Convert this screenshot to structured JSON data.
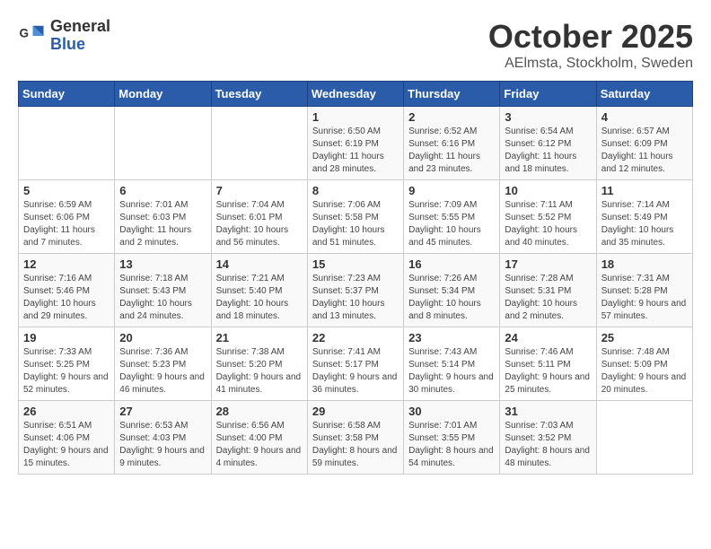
{
  "header": {
    "logo_general": "General",
    "logo_blue": "Blue",
    "title": "October 2025",
    "subtitle": "AElmsta, Stockholm, Sweden"
  },
  "weekdays": [
    "Sunday",
    "Monday",
    "Tuesday",
    "Wednesday",
    "Thursday",
    "Friday",
    "Saturday"
  ],
  "weeks": [
    [
      {
        "day": "",
        "info": ""
      },
      {
        "day": "",
        "info": ""
      },
      {
        "day": "",
        "info": ""
      },
      {
        "day": "1",
        "info": "Sunrise: 6:50 AM\nSunset: 6:19 PM\nDaylight: 11 hours\nand 28 minutes."
      },
      {
        "day": "2",
        "info": "Sunrise: 6:52 AM\nSunset: 6:16 PM\nDaylight: 11 hours\nand 23 minutes."
      },
      {
        "day": "3",
        "info": "Sunrise: 6:54 AM\nSunset: 6:12 PM\nDaylight: 11 hours\nand 18 minutes."
      },
      {
        "day": "4",
        "info": "Sunrise: 6:57 AM\nSunset: 6:09 PM\nDaylight: 11 hours\nand 12 minutes."
      }
    ],
    [
      {
        "day": "5",
        "info": "Sunrise: 6:59 AM\nSunset: 6:06 PM\nDaylight: 11 hours\nand 7 minutes."
      },
      {
        "day": "6",
        "info": "Sunrise: 7:01 AM\nSunset: 6:03 PM\nDaylight: 11 hours\nand 2 minutes."
      },
      {
        "day": "7",
        "info": "Sunrise: 7:04 AM\nSunset: 6:01 PM\nDaylight: 10 hours\nand 56 minutes."
      },
      {
        "day": "8",
        "info": "Sunrise: 7:06 AM\nSunset: 5:58 PM\nDaylight: 10 hours\nand 51 minutes."
      },
      {
        "day": "9",
        "info": "Sunrise: 7:09 AM\nSunset: 5:55 PM\nDaylight: 10 hours\nand 45 minutes."
      },
      {
        "day": "10",
        "info": "Sunrise: 7:11 AM\nSunset: 5:52 PM\nDaylight: 10 hours\nand 40 minutes."
      },
      {
        "day": "11",
        "info": "Sunrise: 7:14 AM\nSunset: 5:49 PM\nDaylight: 10 hours\nand 35 minutes."
      }
    ],
    [
      {
        "day": "12",
        "info": "Sunrise: 7:16 AM\nSunset: 5:46 PM\nDaylight: 10 hours\nand 29 minutes."
      },
      {
        "day": "13",
        "info": "Sunrise: 7:18 AM\nSunset: 5:43 PM\nDaylight: 10 hours\nand 24 minutes."
      },
      {
        "day": "14",
        "info": "Sunrise: 7:21 AM\nSunset: 5:40 PM\nDaylight: 10 hours\nand 18 minutes."
      },
      {
        "day": "15",
        "info": "Sunrise: 7:23 AM\nSunset: 5:37 PM\nDaylight: 10 hours\nand 13 minutes."
      },
      {
        "day": "16",
        "info": "Sunrise: 7:26 AM\nSunset: 5:34 PM\nDaylight: 10 hours\nand 8 minutes."
      },
      {
        "day": "17",
        "info": "Sunrise: 7:28 AM\nSunset: 5:31 PM\nDaylight: 10 hours\nand 2 minutes."
      },
      {
        "day": "18",
        "info": "Sunrise: 7:31 AM\nSunset: 5:28 PM\nDaylight: 9 hours\nand 57 minutes."
      }
    ],
    [
      {
        "day": "19",
        "info": "Sunrise: 7:33 AM\nSunset: 5:25 PM\nDaylight: 9 hours\nand 52 minutes."
      },
      {
        "day": "20",
        "info": "Sunrise: 7:36 AM\nSunset: 5:23 PM\nDaylight: 9 hours\nand 46 minutes."
      },
      {
        "day": "21",
        "info": "Sunrise: 7:38 AM\nSunset: 5:20 PM\nDaylight: 9 hours\nand 41 minutes."
      },
      {
        "day": "22",
        "info": "Sunrise: 7:41 AM\nSunset: 5:17 PM\nDaylight: 9 hours\nand 36 minutes."
      },
      {
        "day": "23",
        "info": "Sunrise: 7:43 AM\nSunset: 5:14 PM\nDaylight: 9 hours\nand 30 minutes."
      },
      {
        "day": "24",
        "info": "Sunrise: 7:46 AM\nSunset: 5:11 PM\nDaylight: 9 hours\nand 25 minutes."
      },
      {
        "day": "25",
        "info": "Sunrise: 7:48 AM\nSunset: 5:09 PM\nDaylight: 9 hours\nand 20 minutes."
      }
    ],
    [
      {
        "day": "26",
        "info": "Sunrise: 6:51 AM\nSunset: 4:06 PM\nDaylight: 9 hours\nand 15 minutes."
      },
      {
        "day": "27",
        "info": "Sunrise: 6:53 AM\nSunset: 4:03 PM\nDaylight: 9 hours\nand 9 minutes."
      },
      {
        "day": "28",
        "info": "Sunrise: 6:56 AM\nSunset: 4:00 PM\nDaylight: 9 hours\nand 4 minutes."
      },
      {
        "day": "29",
        "info": "Sunrise: 6:58 AM\nSunset: 3:58 PM\nDaylight: 8 hours\nand 59 minutes."
      },
      {
        "day": "30",
        "info": "Sunrise: 7:01 AM\nSunset: 3:55 PM\nDaylight: 8 hours\nand 54 minutes."
      },
      {
        "day": "31",
        "info": "Sunrise: 7:03 AM\nSunset: 3:52 PM\nDaylight: 8 hours\nand 48 minutes."
      },
      {
        "day": "",
        "info": ""
      }
    ]
  ]
}
